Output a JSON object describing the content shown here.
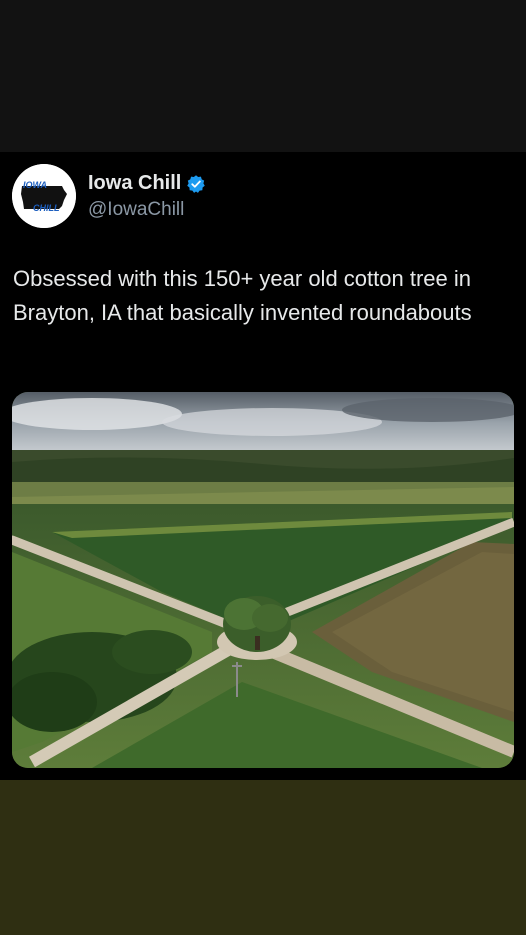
{
  "account": {
    "display_name": "Iowa Chill",
    "handle": "@IowaChill",
    "avatar_text_top": "IOWA",
    "avatar_text_bottom": "CHILL",
    "verified": true
  },
  "tweet": {
    "text": "Obsessed with this 150+ year old cotton tree in Brayton, IA that basically invented roundabouts"
  },
  "media": {
    "subject": "aerial photo of a lone cottonwood tree in the middle of a gravel road intersection surrounded by farm fields"
  },
  "colors": {
    "top_band": "#121212",
    "tweet_background": "#000000",
    "bottom_band": "#2f2f12",
    "verified_badge": "#1d9bf0",
    "handle_text": "#8b98a5"
  }
}
